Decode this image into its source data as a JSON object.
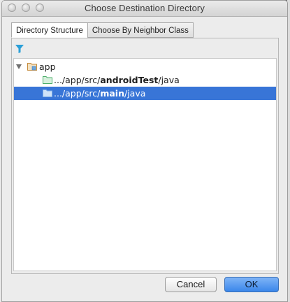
{
  "window": {
    "title": "Choose Destination Directory"
  },
  "tabs": [
    {
      "label": "Directory Structure",
      "active": true
    },
    {
      "label": "Choose By Neighbor Class",
      "active": false
    }
  ],
  "tree": {
    "root": {
      "label": "app",
      "expanded": true
    },
    "items": [
      {
        "prefix": ".../app/src/",
        "bold": "androidTest",
        "suffix": "/java",
        "selected": false
      },
      {
        "prefix": ".../app/src/",
        "bold": "main",
        "suffix": "/java",
        "selected": true
      }
    ]
  },
  "buttons": {
    "cancel_label": "Cancel",
    "ok_label": "OK"
  },
  "colors": {
    "selection": "#3875d7",
    "ok_button": "#3a86ea",
    "filter_icon": "#2a9fd8",
    "folder_test": "#4caf6a",
    "folder_main": "#7fb0e8",
    "module_icon": "#c48a3a"
  },
  "icons": {
    "filter": "filter-icon",
    "root": "module-folder-icon",
    "test_folder": "test-folder-icon",
    "source_folder": "source-folder-icon"
  }
}
